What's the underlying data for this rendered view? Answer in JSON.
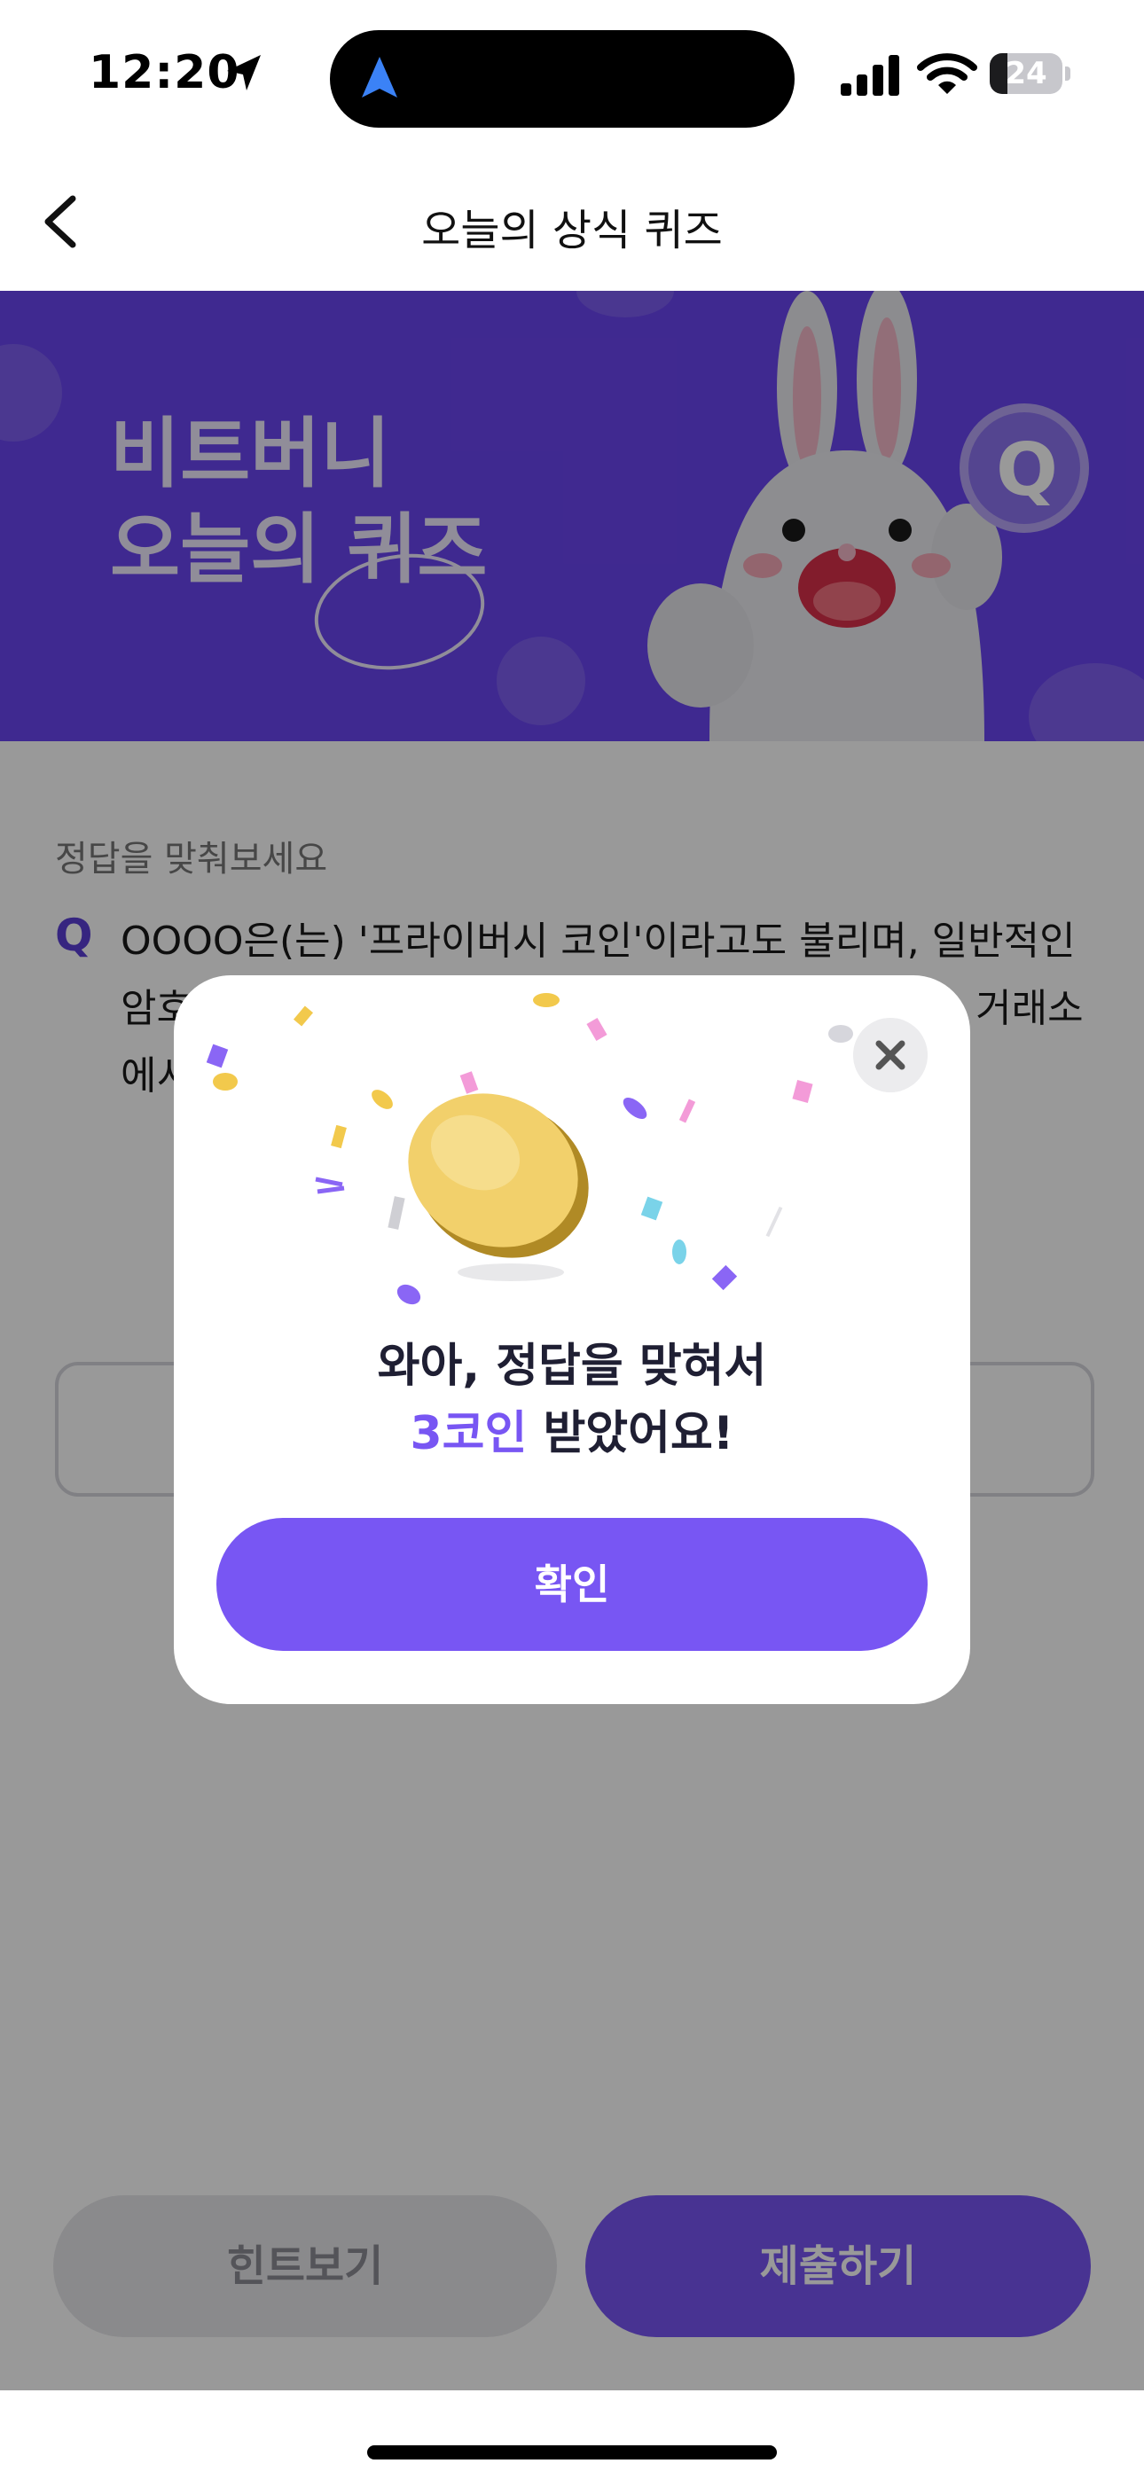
{
  "status_bar": {
    "time": "12:20",
    "battery": "24",
    "battery_level": 0.24
  },
  "nav": {
    "title": "오늘의 상식 퀴즈"
  },
  "banner": {
    "line1": "비트버니",
    "line2": "오늘의 퀴즈",
    "badge": "Q"
  },
  "quiz": {
    "prompt_label": "정답을 맞춰보세요",
    "q_mark": "Q",
    "question": "OOOO은(는) '프라이버시 코인'이라고도 불리며, 일반적인 암호 ... 지 않아요. ... R), 지캐시 ... 특성 때문에 ... 거래소에서 ..."
  },
  "actions": {
    "hint": "힌트보기",
    "submit": "제출하기"
  },
  "modal": {
    "line1": "와아, 정답을 맞혀서",
    "accent": "3코인",
    "line2_rest": " 받았어요!",
    "confirm": "확인"
  },
  "colors": {
    "brand": "#7856f3",
    "banner": "#6a45f0",
    "dim": "rgba(0,0,0,0.40)"
  }
}
